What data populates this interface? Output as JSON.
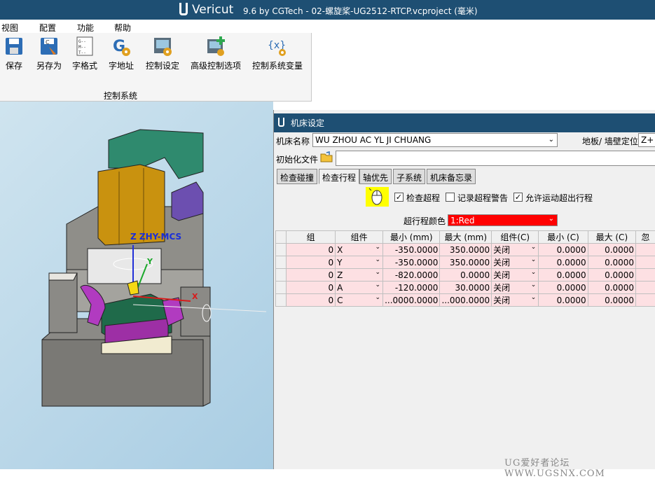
{
  "app": {
    "name": "Vericut",
    "title": "9.6 by CGTech - 02-螺旋桨-UG2512-RTCP.vcproject (毫米)"
  },
  "menu": [
    "视图",
    "配置",
    "功能",
    "帮助"
  ],
  "ribbon": {
    "buttons": [
      {
        "label": "保存",
        "icon": "save-icon"
      },
      {
        "label": "另存为",
        "icon": "save-as-icon"
      },
      {
        "label": "字格式",
        "icon": "word-format-icon"
      },
      {
        "label": "字地址",
        "icon": "word-address-icon"
      },
      {
        "label": "控制设定",
        "icon": "control-settings-icon"
      },
      {
        "label": "高级控制选项",
        "icon": "advanced-control-icon"
      },
      {
        "label": "控制系统变量",
        "icon": "control-variables-icon"
      }
    ],
    "group_label": "控制系统"
  },
  "viewport": {
    "csys_label": "Z ZHY-MCS",
    "axis_y": "Y",
    "axis_x": "X"
  },
  "dialog": {
    "title": "机床设定",
    "machine_name_label": "机床名称",
    "machine_name_value": "WU ZHOU AC YL JI CHUANG",
    "floor_label": "地板/ 墙壁定位",
    "floor_value": "Z+",
    "init_file_label": "初始化文件",
    "tabs": [
      "检查碰撞",
      "检查行程",
      "轴优先",
      "子系统",
      "机床备忘录"
    ],
    "active_tab": "检查行程",
    "check_overtravel_label": "检查超程",
    "check_overtravel": true,
    "log_warning_label": "记录超程警告",
    "log_warning": false,
    "allow_motion_label": "允许运动超出行程",
    "allow_motion": true,
    "overtravel_color_label": "超行程颜色",
    "overtravel_color_value": "1:Red",
    "overtravel_color_hex": "#ff0000",
    "table": {
      "headers": [
        "组",
        "组件",
        "最小 (mm)",
        "最大 (mm)",
        "组件(C)",
        "最小 (C)",
        "最大 (C)",
        "忽"
      ],
      "rows": [
        {
          "group": "0",
          "component": "X",
          "min": "-350.0000",
          "max": "350.0000",
          "compc": "关闭",
          "minc": "0.0000",
          "maxc": "0.0000"
        },
        {
          "group": "0",
          "component": "Y",
          "min": "-350.0000",
          "max": "350.0000",
          "compc": "关闭",
          "minc": "0.0000",
          "maxc": "0.0000"
        },
        {
          "group": "0",
          "component": "Z",
          "min": "-820.0000",
          "max": "0.0000",
          "compc": "关闭",
          "minc": "0.0000",
          "maxc": "0.0000"
        },
        {
          "group": "0",
          "component": "A",
          "min": "-120.0000",
          "max": "30.0000",
          "compc": "关闭",
          "minc": "0.0000",
          "maxc": "0.0000"
        },
        {
          "group": "0",
          "component": "C",
          "min": "...0000.0000",
          "max": "...000.0000",
          "compc": "关闭",
          "minc": "0.0000",
          "maxc": "0.0000"
        }
      ]
    }
  },
  "watermark": "UG爱好者论坛 WWW.UGSNX.COM"
}
